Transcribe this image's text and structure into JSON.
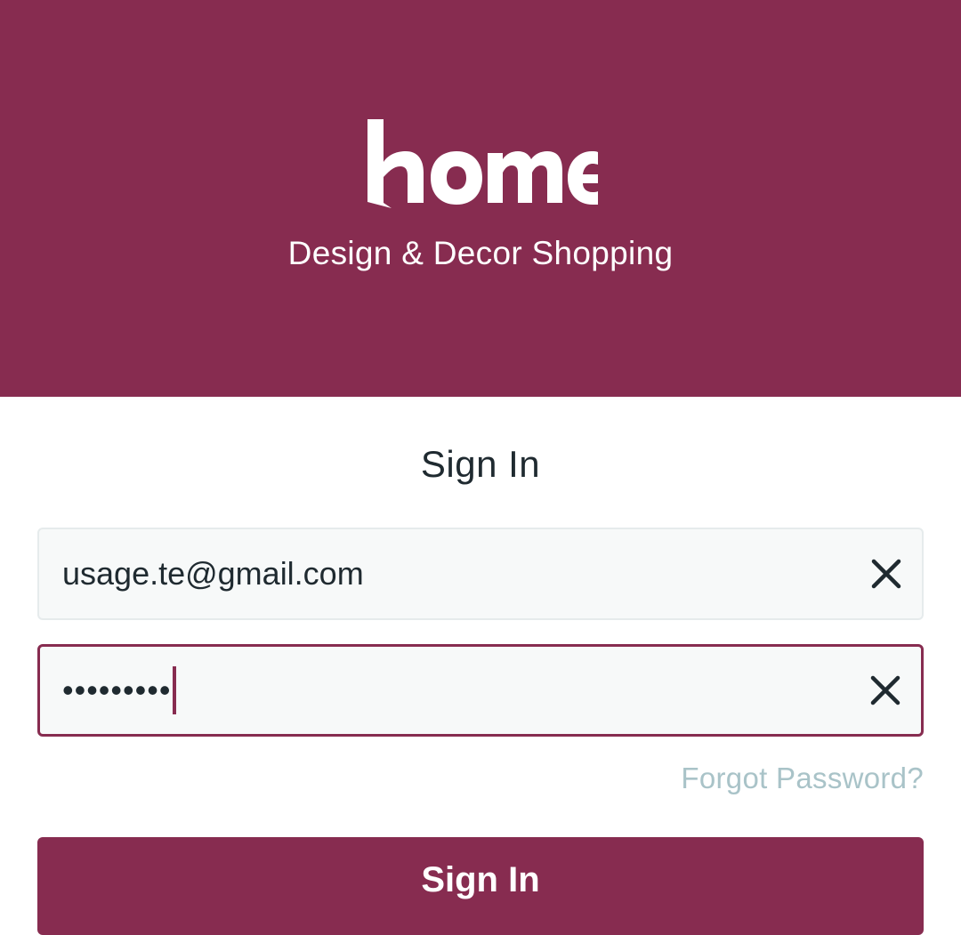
{
  "brand": {
    "logo_text": "home",
    "tagline": "Design & Decor Shopping",
    "color": "#872c50"
  },
  "form": {
    "title": "Sign In",
    "email": {
      "value": "usage.te@gmail.com",
      "clear_icon": "close-icon"
    },
    "password": {
      "masked_value": "•••••••••",
      "clear_icon": "close-icon"
    },
    "forgot_label": "Forgot Password?",
    "submit_label": "Sign In"
  }
}
